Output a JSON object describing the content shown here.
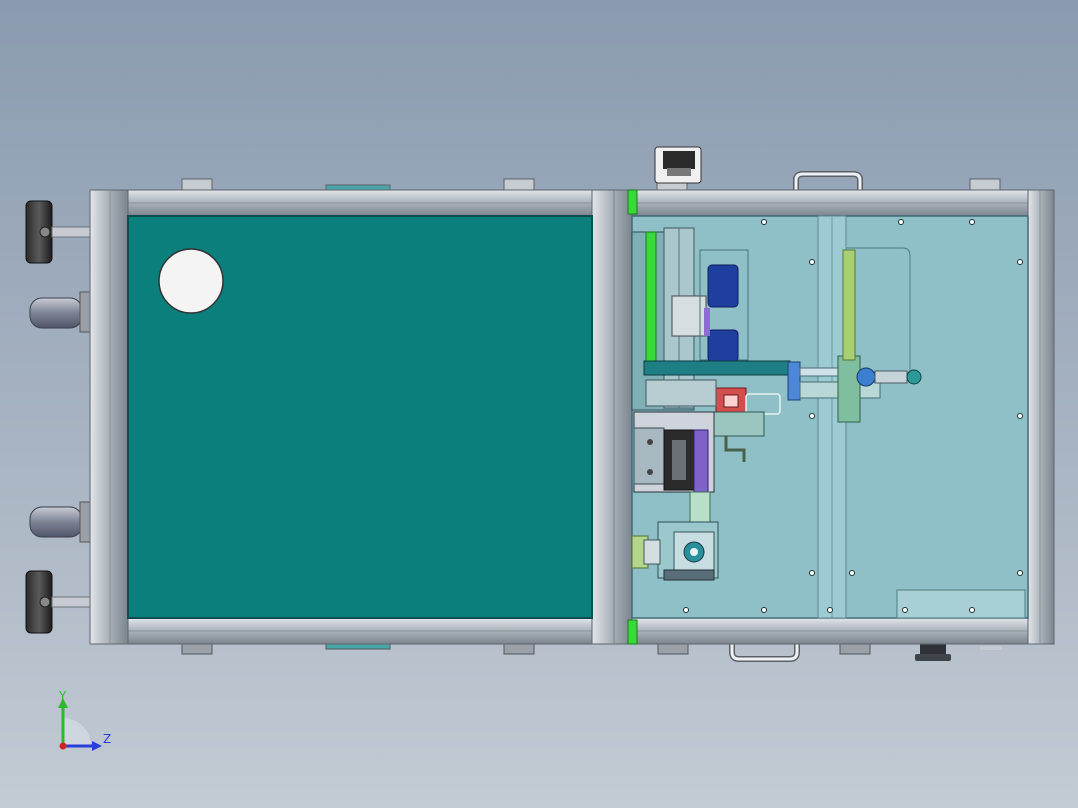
{
  "viewport": {
    "background_top": "#8a9ab0",
    "background_bottom": "#c3cbd4"
  },
  "triad": {
    "y_label": "Y",
    "z_label": "Z",
    "y_color": "#2fb82f",
    "z_color": "#2a3fd8",
    "origin_color": "#d42020"
  },
  "model": {
    "frame_color": "#b4bcc4",
    "left_panel_color": "#0b7f7c",
    "right_panel_color": "#8fc0c8",
    "accent_green": "#3ad93a",
    "accent_blue": "#1f3f9f"
  }
}
